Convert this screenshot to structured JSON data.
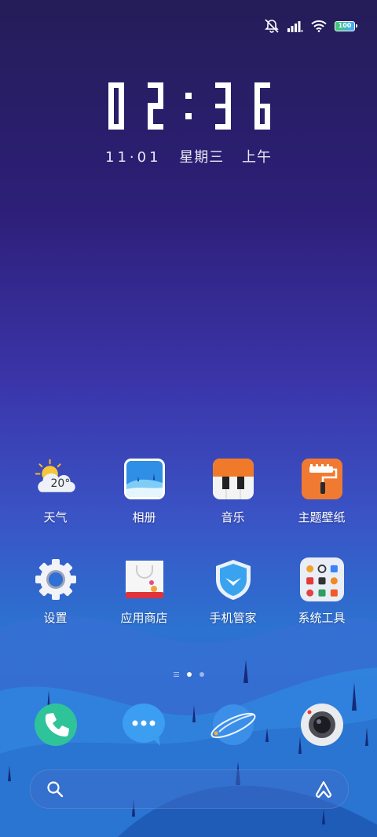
{
  "status_bar": {
    "icons": [
      "mute-notifications-icon",
      "signal-icon",
      "wifi-icon",
      "battery-icon"
    ],
    "battery_text": "100"
  },
  "lock": {
    "time": "02:36",
    "date": "11·01",
    "weekday": "星期三",
    "period": "上午"
  },
  "apps": [
    {
      "label": "天气",
      "icon": "weather-icon",
      "temp": "20°"
    },
    {
      "label": "相册",
      "icon": "gallery-icon"
    },
    {
      "label": "音乐",
      "icon": "music-icon"
    },
    {
      "label": "主题壁纸",
      "icon": "theme-wallpaper-icon"
    },
    {
      "label": "设置",
      "icon": "settings-icon"
    },
    {
      "label": "应用商店",
      "icon": "app-store-icon"
    },
    {
      "label": "手机管家",
      "icon": "phone-manager-icon"
    },
    {
      "label": "系统工具",
      "icon": "system-tools-folder-icon"
    }
  ],
  "pages": {
    "count": 2,
    "current": 1
  },
  "dock": [
    "phone-icon",
    "messages-icon",
    "browser-icon",
    "camera-icon"
  ],
  "search": {
    "icons": [
      "search-icon",
      "assistant-icon"
    ]
  },
  "colors": {
    "accent": "#2f6fd6",
    "bg_top": "#241d58",
    "bg_bottom": "#2f63c6"
  }
}
